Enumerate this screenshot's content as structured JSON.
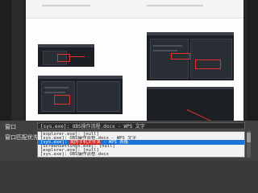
{
  "dialog": {
    "window_label": "窗口",
    "window_value": "[sys.exe]: OBS操作流程.docx - WPS 文字",
    "match_label": "窗口匹配优先级",
    "window_options": [
      "[explorer.exe]: [null]",
      "[sys.exe]: OBS操作流程.docx - WPS 文字",
      "[sys.exe]: 我的手机文件夹 - WPS 表格",
      "[ScreenSettings.exe]: [null]",
      "[explorer.exe]: [null]",
      "[sys.exe]: OBS操作流程.docx"
    ],
    "selected_option_prefix": "[sys.exe]: ",
    "selected_option_highlight": "我的手机文件夹",
    "selected_option_suffix": " - WPS 表格"
  },
  "colors": {
    "dialog_bg": "#404040",
    "selection": "#1a73d9",
    "highlight": "#d02020",
    "annotation_red": "#e63030"
  },
  "icons": {
    "list_scrollbar": "scrollbar"
  }
}
